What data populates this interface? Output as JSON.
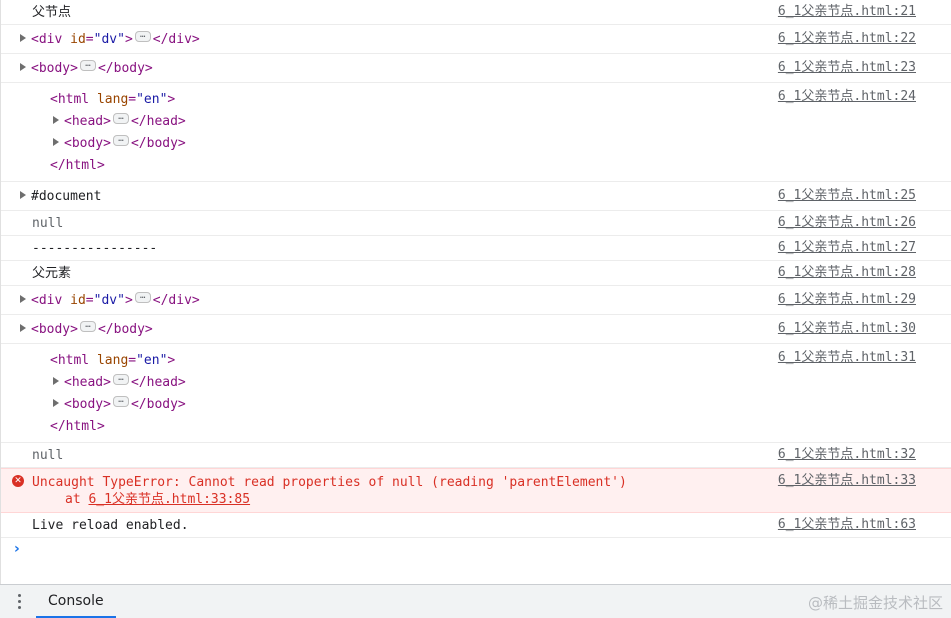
{
  "console": {
    "rows": [
      {
        "text": "父节点",
        "source": "6_1父亲节点.html:21"
      },
      {
        "tag_open": "<div",
        "attr_name": "id",
        "attr_value": "\"dv\"",
        "tag_close": "</div>",
        "source": "6_1父亲节点.html:22"
      },
      {
        "tag_open": "<body>",
        "tag_close": "</body>",
        "source": "6_1父亲节点.html:23"
      },
      {
        "html_open": "<html",
        "attr_name": "lang",
        "attr_value": "\"en\"",
        "head_open": "<head>",
        "head_close": "</head>",
        "body_open": "<body>",
        "body_close": "</body>",
        "html_close": "</html>",
        "source": "6_1父亲节点.html:24"
      },
      {
        "text": "#document",
        "source": "6_1父亲节点.html:25"
      },
      {
        "text": "null",
        "source": "6_1父亲节点.html:26"
      },
      {
        "text": "----------------",
        "source": "6_1父亲节点.html:27"
      },
      {
        "text": "父元素",
        "source": "6_1父亲节点.html:28"
      },
      {
        "tag_open": "<div",
        "attr_name": "id",
        "attr_value": "\"dv\"",
        "tag_close": "</div>",
        "source": "6_1父亲节点.html:29"
      },
      {
        "tag_open": "<body>",
        "tag_close": "</body>",
        "source": "6_1父亲节点.html:30"
      },
      {
        "html_open": "<html",
        "attr_name": "lang",
        "attr_value": "\"en\"",
        "head_open": "<head>",
        "head_close": "</head>",
        "body_open": "<body>",
        "body_close": "</body>",
        "html_close": "</html>",
        "source": "6_1父亲节点.html:31"
      },
      {
        "text": "null",
        "source": "6_1父亲节点.html:32"
      },
      {
        "error": "Uncaught TypeError: Cannot read properties of null (reading 'parentElement')",
        "at_label": "at",
        "at_link": "6_1父亲节点.html:33:85",
        "source": "6_1父亲节点.html:33"
      },
      {
        "text": "Live reload enabled.",
        "source": "6_1父亲节点.html:63"
      }
    ],
    "prompt_symbol": "›",
    "ellipsis": "…",
    "tag_end": ">"
  },
  "drawer": {
    "tab_label": "Console",
    "watermark": "@稀土掘金技术社区"
  },
  "colors": {
    "tag": "#881280",
    "attr_name": "#994500",
    "attr_value": "#1a1aa6",
    "error": "#d93025",
    "error_bg": "#fff0f0",
    "prompt": "#1a73e8"
  }
}
